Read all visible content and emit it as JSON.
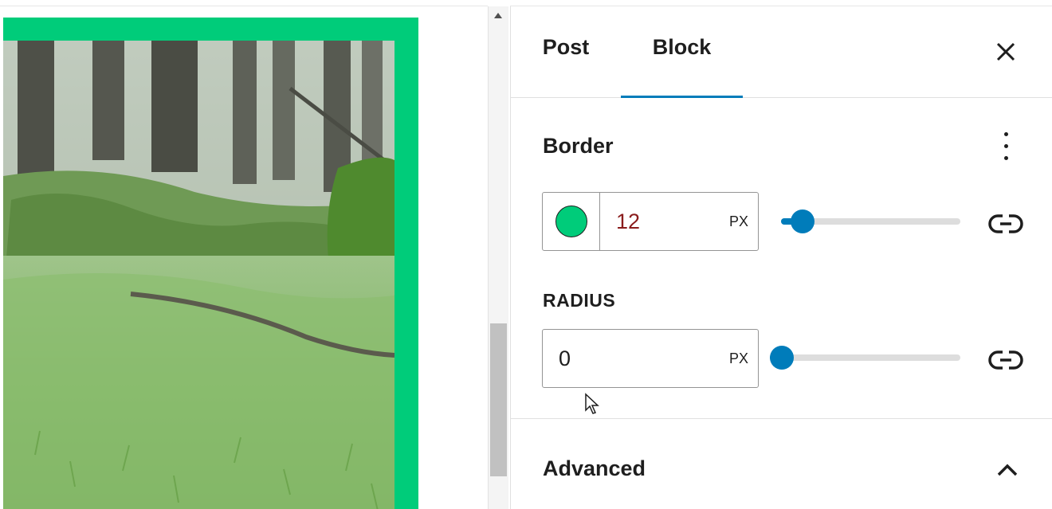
{
  "sidebar": {
    "tabs": [
      {
        "label": "Post",
        "active": false
      },
      {
        "label": "Block",
        "active": true
      }
    ],
    "accent_color": "#007cba"
  },
  "border_panel": {
    "title": "Border",
    "color": "#00cc7a",
    "width": {
      "value": "12",
      "unit": "PX",
      "slider_fraction": 0.12
    },
    "radius": {
      "label": "RADIUS",
      "value": "0",
      "unit": "PX",
      "slider_fraction": 0.0
    }
  },
  "advanced_panel": {
    "title": "Advanced",
    "expanded": true
  },
  "icons": [
    "close-icon",
    "more-vertical-icon",
    "link-icon",
    "chevron-up-icon",
    "mouse-pointer-icon"
  ]
}
